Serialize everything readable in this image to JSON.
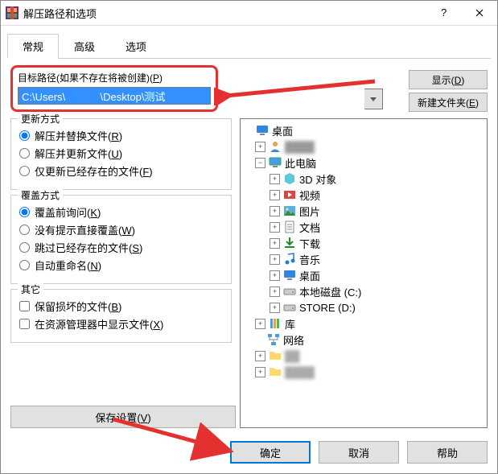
{
  "window": {
    "title": "解压路径和选项"
  },
  "tabs": {
    "general": "常规",
    "advanced": "高级",
    "options": "选项"
  },
  "path": {
    "label_prefix": "目标路径(如果不存在将被创建)(",
    "label_hotkey": "P",
    "label_suffix": ")",
    "value": "C:\\Users\\            \\Desktop\\测试"
  },
  "side": {
    "display_prefix": "显示(",
    "display_hotkey": "D",
    "display_suffix": ")",
    "newfolder_prefix": "新建文件夹(",
    "newfolder_hotkey": "E",
    "newfolder_suffix": ")"
  },
  "update": {
    "title": "更新方式",
    "r1_prefix": "解压并替换文件(",
    "r1_k": "R",
    "r1_suffix": ")",
    "r2_prefix": "解压并更新文件(",
    "r2_k": "U",
    "r2_suffix": ")",
    "r3_prefix": "仅更新已经存在的文件(",
    "r3_k": "F",
    "r3_suffix": ")"
  },
  "overwrite": {
    "title": "覆盖方式",
    "r1_prefix": "覆盖前询问(",
    "r1_k": "K",
    "r1_suffix": ")",
    "r2_prefix": "没有提示直接覆盖(",
    "r2_k": "W",
    "r2_suffix": ")",
    "r3_prefix": "跳过已经存在的文件(",
    "r3_k": "S",
    "r3_suffix": ")",
    "r4_prefix": "自动重命名(",
    "r4_k": "N",
    "r4_suffix": ")"
  },
  "misc": {
    "title": "其它",
    "c1_prefix": "保留损坏的文件(",
    "c1_k": "B",
    "c1_suffix": ")",
    "c2_prefix": "在资源管理器中显示文件(",
    "c2_k": "X",
    "c2_suffix": ")"
  },
  "save": {
    "label_prefix": "保存设置(",
    "label_hotkey": "V",
    "label_suffix": ")"
  },
  "tree": {
    "desktop": "桌面",
    "thispc": "此电脑",
    "obj3d": "3D 对象",
    "video": "视频",
    "pictures": "图片",
    "docs": "文档",
    "downloads": "下载",
    "music": "音乐",
    "desk2": "桌面",
    "cdrive": "本地磁盘 (C:)",
    "ddrive": "STORE (D:)",
    "lib": "库",
    "network": "网络"
  },
  "footer": {
    "ok": "确定",
    "cancel": "取消",
    "help": "帮助"
  }
}
